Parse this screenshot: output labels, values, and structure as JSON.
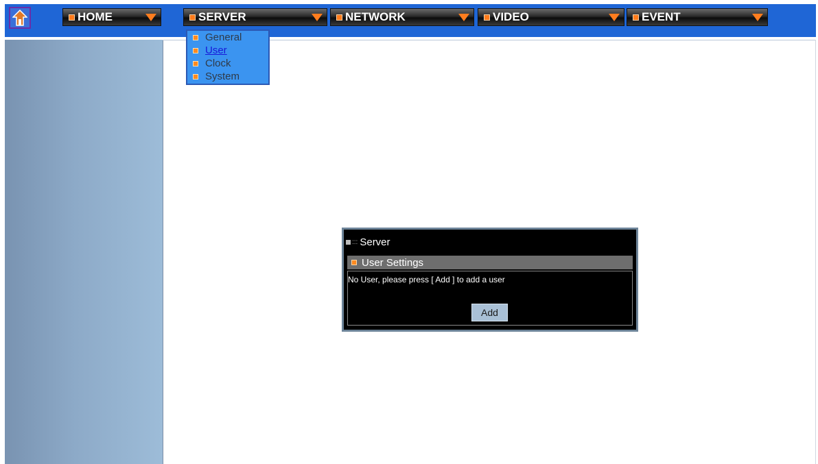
{
  "nav": {
    "home_icon": "home-icon",
    "menus": [
      {
        "label": "HOME"
      },
      {
        "label": "SERVER"
      },
      {
        "label": "NETWORK"
      },
      {
        "label": "VIDEO"
      },
      {
        "label": "EVENT"
      }
    ]
  },
  "server_dropdown": {
    "items": [
      {
        "label": "General"
      },
      {
        "label": "User"
      },
      {
        "label": "Clock"
      },
      {
        "label": "System"
      }
    ]
  },
  "panel": {
    "title": "Server",
    "section": "User Settings",
    "message": "No User, please press [ Add ] to add a user",
    "add_label": "Add"
  },
  "colors": {
    "topbar": "#1f66d6",
    "accent_orange": "#ff7a1a",
    "dropdown_bg": "#3b94f0"
  }
}
